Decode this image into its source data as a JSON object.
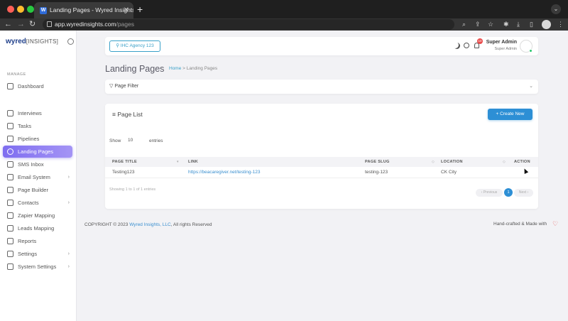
{
  "browser": {
    "tab_title": "Landing Pages - Wyred Insights",
    "tab_favicon": "W",
    "url_host": "app.wyredinsights.com",
    "url_path": "/pages"
  },
  "sidebar": {
    "logo_brand": "wyred",
    "logo_rest": "[INSIGHTS]",
    "section_label": "MANAGE",
    "items": [
      {
        "label": "Dashboard",
        "icon": "home-icon"
      },
      {
        "label": "Interviews",
        "icon": "clock-icon"
      },
      {
        "label": "Tasks",
        "icon": "clipboard-icon"
      },
      {
        "label": "Pipelines",
        "icon": "file-icon"
      },
      {
        "label": "Landing Pages",
        "icon": "globe-icon",
        "active": true
      },
      {
        "label": "SMS Inbox",
        "icon": "message-icon"
      },
      {
        "label": "Email System",
        "icon": "mail-icon",
        "has_children": true
      },
      {
        "label": "Page Builder",
        "icon": "edit-icon"
      },
      {
        "label": "Contacts",
        "icon": "users-icon",
        "has_children": true
      },
      {
        "label": "Zapier Mapping",
        "icon": "zap-icon"
      },
      {
        "label": "Leads Mapping",
        "icon": "map-icon"
      },
      {
        "label": "Reports",
        "icon": "report-icon"
      },
      {
        "label": "Settings",
        "icon": "settings-icon",
        "has_children": true
      },
      {
        "label": "System Settings",
        "icon": "gear-icon",
        "has_children": true
      }
    ]
  },
  "header": {
    "agency_label": "IHC Agency 123",
    "notification_count": "10",
    "user_name": "Super Admin",
    "user_role": "Super Admin"
  },
  "page": {
    "title": "Landing Pages",
    "breadcrumb_home": "Home",
    "breadcrumb_sep": ">",
    "breadcrumb_current": "Landing Pages"
  },
  "filter": {
    "title": "Page Filter"
  },
  "list": {
    "title": "Page List",
    "create_label": "+ Create New",
    "show_label": "Show",
    "entries_value": "10",
    "entries_label": "entries",
    "columns": [
      "PAGE TITLE",
      "LINK",
      "PAGE SLUG",
      "LOCATION",
      "ACTION"
    ],
    "rows": [
      {
        "title": "Testing123",
        "link": "https://beacaregiver.net/testing-123",
        "slug": "testing-123",
        "location": "CK City"
      }
    ],
    "showing_text": "Showing 1 to 1 of 1 entries",
    "prev_label": "Previous",
    "current_page": "1",
    "next_label": "Next"
  },
  "footer": {
    "copyright_prefix": "COPYRIGHT © 2023",
    "brand": "Wyred Insights, LLC",
    "copyright_suffix": ", All rights Reserved",
    "right_text": "Hand-crafted & Made with"
  }
}
